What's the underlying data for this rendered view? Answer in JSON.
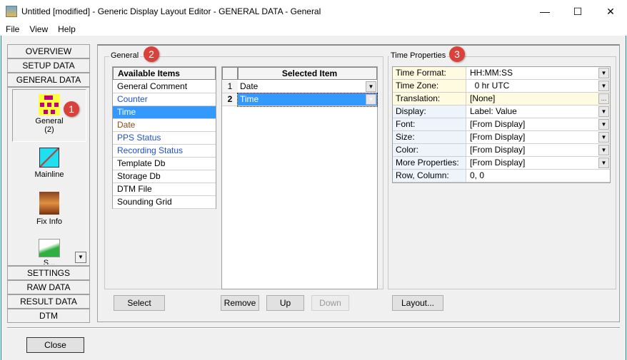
{
  "window": {
    "title": "Untitled [modified] - Generic Display Layout Editor -  GENERAL DATA -  General"
  },
  "menu": [
    "File",
    "View",
    "Help"
  ],
  "nav": {
    "top_tabs": [
      "OVERVIEW",
      "SETUP DATA",
      "GENERAL DATA"
    ],
    "items": [
      {
        "label": "General",
        "sub": "(2)"
      },
      {
        "label": "Mainline"
      },
      {
        "label": "Fix Info"
      },
      {
        "label": "S..."
      }
    ],
    "bottom_tabs": [
      "SETTINGS",
      "RAW DATA",
      "RESULT DATA",
      "DTM"
    ]
  },
  "general": {
    "title": "General",
    "available_header": "Available Items",
    "available": [
      {
        "label": "General Comment",
        "color": "#000000"
      },
      {
        "label": "Counter",
        "color": "#1f4fd0"
      },
      {
        "label": "Time",
        "color": "#ffffff",
        "selected": true
      },
      {
        "label": "Date",
        "color": "#8b4a10"
      },
      {
        "label": "PPS Status",
        "color": "#1f4fd0"
      },
      {
        "label": "Recording Status",
        "color": "#1f4fd0"
      },
      {
        "label": "Template Db",
        "color": "#000000"
      },
      {
        "label": "Storage Db",
        "color": "#000000"
      },
      {
        "label": "DTM File",
        "color": "#000000"
      },
      {
        "label": "Sounding Grid",
        "color": "#000000"
      }
    ],
    "selected_header": "Selected Item",
    "selected": [
      {
        "num": "1",
        "label": "Date"
      },
      {
        "num": "2",
        "label": "Time"
      }
    ],
    "buttons": {
      "select": "Select",
      "remove": "Remove",
      "up": "Up",
      "down": "Down"
    }
  },
  "time_properties": {
    "title": "Time Properties",
    "rows": [
      {
        "label": "Time Format:",
        "value": "HH:MM:SS",
        "ctl": "dd",
        "hl": true
      },
      {
        "label": "Time Zone:",
        "value": "  0 hr UTC",
        "ctl": "dd",
        "hl": true
      },
      {
        "label": "Translation:",
        "value": "[None]",
        "ctl": "...",
        "hl": true
      },
      {
        "label": "Display:",
        "value": "Label: Value",
        "ctl": "dd"
      },
      {
        "label": "Font:",
        "value": "[From Display]",
        "ctl": "dd"
      },
      {
        "label": "Size:",
        "value": "[From Display]",
        "ctl": "dd"
      },
      {
        "label": "Color:",
        "value": "[From Display]",
        "ctl": "dd"
      },
      {
        "label": "More Properties:",
        "value": "[From Display]",
        "ctl": "dd"
      },
      {
        "label": "Row, Column:",
        "value": "0, 0",
        "ctl": ""
      }
    ],
    "layout_button": "Layout..."
  },
  "annotations": [
    "1",
    "2",
    "3"
  ],
  "close_button": "Close"
}
